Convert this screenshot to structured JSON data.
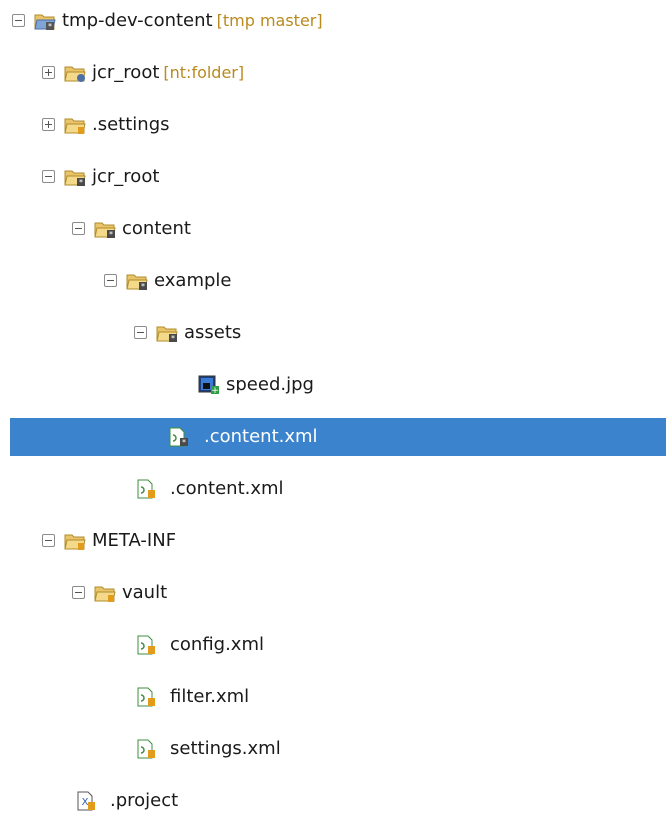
{
  "tree": {
    "nodes": [
      {
        "label": "tmp-dev-content",
        "decoration": "[tmp master]",
        "icon": "project-folder-icon",
        "expanded": true
      },
      {
        "label": "jcr_root",
        "decoration": "[nt:folder]",
        "icon": "folder-repo-icon",
        "expanded": false
      },
      {
        "label": ".settings",
        "icon": "folder-locked-icon",
        "expanded": false
      },
      {
        "label": "jcr_root",
        "icon": "folder-modified-icon",
        "expanded": true
      },
      {
        "label": "content",
        "icon": "folder-modified-icon",
        "expanded": true
      },
      {
        "label": "example",
        "icon": "folder-modified-icon",
        "expanded": true
      },
      {
        "label": "assets",
        "icon": "folder-modified-icon",
        "expanded": true
      },
      {
        "label": "speed.jpg",
        "icon": "image-file-added-icon"
      },
      {
        "label": ".content.xml",
        "icon": "xml-file-modified-icon",
        "selected": true
      },
      {
        "label": ".content.xml",
        "icon": "xml-file-icon"
      },
      {
        "label": "META-INF",
        "icon": "folder-locked-icon",
        "expanded": true
      },
      {
        "label": "vault",
        "icon": "folder-locked-icon",
        "expanded": true
      },
      {
        "label": "config.xml",
        "icon": "xml-file-icon"
      },
      {
        "label": "filter.xml",
        "icon": "xml-file-icon"
      },
      {
        "label": "settings.xml",
        "icon": "xml-file-icon"
      },
      {
        "label": ".project",
        "icon": "project-file-icon"
      }
    ]
  },
  "colors": {
    "selection": "#3b83cd",
    "folder": "#e9c46a",
    "badge_gray": "#4a4a4a",
    "badge_lock": "#e39b1b",
    "decoration": "#b98a1e"
  }
}
